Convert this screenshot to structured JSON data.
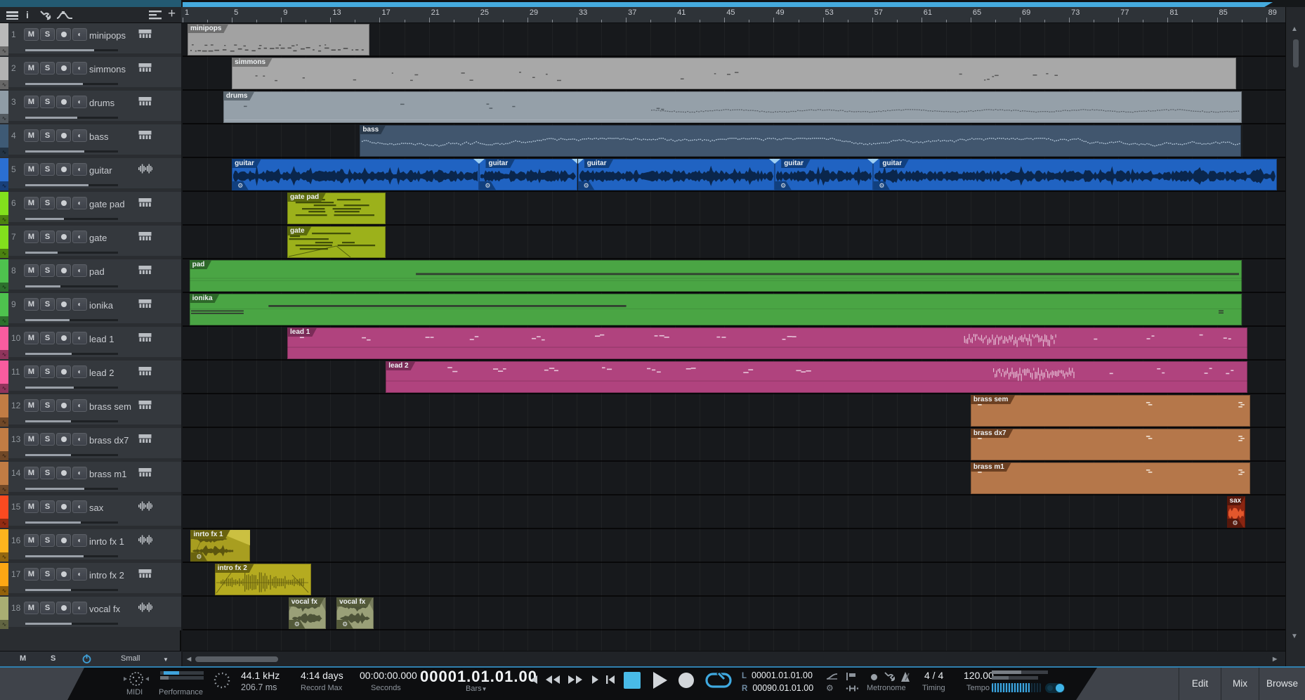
{
  "ruler": {
    "bar_label_start": 1,
    "bar_label_step": 4,
    "bar_label_end": 89,
    "loop_start_bar": 1,
    "loop_end_bar": 90
  },
  "toolbar": {
    "plus": "+",
    "info": "i"
  },
  "tracks": [
    {
      "num": "1",
      "name": "minipops",
      "type": "midi",
      "color": "#b9b9b9",
      "clipBody": "#a2a2a2",
      "clipTab": "#6f6f6f",
      "ink": "#3f3f3f",
      "vol": 0.74
    },
    {
      "num": "2",
      "name": "simmons",
      "type": "midi",
      "color": "#b2b2b2",
      "clipBody": "#a8a8a8",
      "clipTab": "#757575",
      "ink": "#4a4a4a",
      "vol": 0.62
    },
    {
      "num": "3",
      "name": "drums",
      "type": "midi",
      "color": "#8f9ca6",
      "clipBody": "#95a0a9",
      "clipTab": "#5f6a73",
      "ink": "#4b535a",
      "vol": 0.56
    },
    {
      "num": "4",
      "name": "bass",
      "type": "midi",
      "color": "#3e5a75",
      "clipBody": "#41566e",
      "clipTab": "#2a3a4c",
      "ink": "#bdd0e2",
      "vol": 0.64
    },
    {
      "num": "5",
      "name": "guitar",
      "type": "audio",
      "color": "#2b6fd2",
      "clipBody": "#2063c2",
      "clipTab": "#11407f",
      "ink": "#0a2346",
      "vol": 0.68
    },
    {
      "num": "6",
      "name": "gate pad",
      "type": "midi",
      "color": "#82e01d",
      "clipBody": "#9cb11b",
      "clipTab": "#5c6b0d",
      "ink": "#333f05",
      "vol": 0.42
    },
    {
      "num": "7",
      "name": "gate",
      "type": "midi",
      "color": "#82e01d",
      "clipBody": "#9cb11b",
      "clipTab": "#5c6b0d",
      "ink": "#333f05",
      "vol": 0.35
    },
    {
      "num": "8",
      "name": "pad",
      "type": "midi",
      "color": "#4ec24e",
      "clipBody": "#4aa544",
      "clipTab": "#2d6829",
      "ink": "#2e2e2e",
      "vol": 0.38
    },
    {
      "num": "9",
      "name": "ionika",
      "type": "midi",
      "color": "#4ec24e",
      "clipBody": "#4aa544",
      "clipTab": "#2d6829",
      "ink": "#2e2e2e",
      "vol": 0.48
    },
    {
      "num": "10",
      "name": "lead 1",
      "type": "midi",
      "color": "#f95c9f",
      "clipBody": "#b0437e",
      "clipTab": "#7b2c58",
      "ink": "#f2dcea",
      "vol": 0.5
    },
    {
      "num": "11",
      "name": "lead 2",
      "type": "midi",
      "color": "#f95c9f",
      "clipBody": "#b0437e",
      "clipTab": "#7b2c58",
      "ink": "#f2dcea",
      "vol": 0.52
    },
    {
      "num": "12",
      "name": "brass sem",
      "type": "midi",
      "color": "#c17c44",
      "clipBody": "#b5774a",
      "clipTab": "#6c4022",
      "ink": "#f4e8dc",
      "vol": 0.49
    },
    {
      "num": "13",
      "name": "brass dx7",
      "type": "midi",
      "color": "#c17c44",
      "clipBody": "#b5774a",
      "clipTab": "#6c4022",
      "ink": "#f4e8dc",
      "vol": 0.49
    },
    {
      "num": "14",
      "name": "brass m1",
      "type": "midi",
      "color": "#c17c44",
      "clipBody": "#b5774a",
      "clipTab": "#6c4022",
      "ink": "#f4e8dc",
      "vol": 0.64
    },
    {
      "num": "15",
      "name": "sax",
      "type": "audio",
      "color": "#fb4a20",
      "clipBody": "#8a2511",
      "clipTab": "#55170b",
      "ink": "#e85a2e",
      "vol": 0.6
    },
    {
      "num": "16",
      "name": "inrto fx 1",
      "type": "audio",
      "color": "#fdb41e",
      "clipBody": "#a89e20",
      "clipTab": "#6a630f",
      "ink": "#5c560e",
      "vol": 0.63
    },
    {
      "num": "17",
      "name": "intro fx 2",
      "type": "midi",
      "color": "#fca714",
      "clipBody": "#b5ab20",
      "clipTab": "#6a630f",
      "ink": "#5f590e",
      "vol": 0.49
    },
    {
      "num": "18",
      "name": "vocal fx",
      "type": "audio",
      "color": "#a9ae73",
      "clipBody": "#9aa078",
      "clipTab": "#545a3a",
      "ink": "#4d5338",
      "vol": 0.5
    }
  ],
  "clips": [
    {
      "track": 0,
      "label": "minipops",
      "start": 1.4,
      "end": 16.2,
      "kind": "dots-dense"
    },
    {
      "track": 1,
      "label": "simmons",
      "start": 5,
      "end": 86.6,
      "kind": "dots-sparse"
    },
    {
      "track": 2,
      "label": "drums",
      "start": 4.3,
      "end": 87,
      "kind": "drums"
    },
    {
      "track": 3,
      "label": "bass",
      "start": 15.4,
      "end": 87,
      "kind": "wave-dotted"
    },
    {
      "track": 4,
      "label": "guitar",
      "start": 5,
      "end": 25.1,
      "kind": "wave",
      "gear": true,
      "fadeTR": true
    },
    {
      "track": 4,
      "label": "guitar",
      "start": 25.1,
      "end": 33.1,
      "kind": "wave",
      "gear": true,
      "fadeTL": true,
      "fadeTR": true
    },
    {
      "track": 4,
      "label": "guitar",
      "start": 33.1,
      "end": 49.1,
      "kind": "wave",
      "gear": true,
      "fadeTL": true,
      "fadeTR": true
    },
    {
      "track": 4,
      "label": "guitar",
      "start": 49.1,
      "end": 57.1,
      "kind": "wave",
      "gear": true,
      "fadeTL": true,
      "fadeTR": true
    },
    {
      "track": 4,
      "label": "guitar",
      "start": 57.1,
      "end": 89.9,
      "kind": "wave",
      "gear": true,
      "fadeTL": true
    },
    {
      "track": 5,
      "label": "gate pad",
      "start": 9.5,
      "end": 17.5,
      "kind": "midi-bars"
    },
    {
      "track": 6,
      "label": "gate",
      "start": 9.5,
      "end": 17.5,
      "kind": "midi-bars-diag"
    },
    {
      "track": 7,
      "label": "pad",
      "start": 1.55,
      "end": 87,
      "kind": "pad-lines"
    },
    {
      "track": 8,
      "label": "ionika",
      "start": 1.55,
      "end": 87,
      "kind": "ionika-lines"
    },
    {
      "track": 9,
      "label": "lead 1",
      "start": 9.5,
      "end": 87.5,
      "kind": "dash-notes"
    },
    {
      "track": 10,
      "label": "lead 2",
      "start": 17.5,
      "end": 87.5,
      "kind": "dash-notes"
    },
    {
      "track": 11,
      "label": "brass sem",
      "start": 65,
      "end": 87.7,
      "kind": "brass-marks"
    },
    {
      "track": 12,
      "label": "brass dx7",
      "start": 65,
      "end": 87.7,
      "kind": "brass-marks"
    },
    {
      "track": 13,
      "label": "brass m1",
      "start": 65,
      "end": 87.7,
      "kind": "brass-marks"
    },
    {
      "track": 14,
      "label": "sax",
      "start": 85.8,
      "end": 87.3,
      "kind": "wave",
      "gear": true
    },
    {
      "track": 15,
      "label": "inrto fx 1",
      "start": 1.65,
      "end": 6.5,
      "kind": "fx1",
      "gear": true
    },
    {
      "track": 16,
      "label": "intro fx 2",
      "start": 3.6,
      "end": 11.4,
      "kind": "fx2"
    },
    {
      "track": 17,
      "label": "vocal fx",
      "start": 9.6,
      "end": 12.6,
      "kind": "vocal",
      "gear": true
    },
    {
      "track": 17,
      "label": "vocal fx",
      "start": 13.5,
      "end": 16.5,
      "kind": "vocal",
      "gear": true
    }
  ],
  "track_buttons": {
    "mute": "M",
    "solo": "S"
  },
  "footer": {
    "mute": "M",
    "solo": "S",
    "size": "Small"
  },
  "transport": {
    "midi_label": "MIDI",
    "performance_label": "Performance",
    "sample_rate": "44.1 kHz",
    "latency": "206.7 ms",
    "record_max_value": "4:14 days",
    "record_max_label": "Record Max",
    "seconds_value": "00:00:00.000",
    "seconds_label": "Seconds",
    "time_display": "00001.01.01.00",
    "time_format_label": "Bars",
    "loop_left_prefix": "L",
    "loop_left": "00001.01.01.00",
    "loop_right_prefix": "R",
    "loop_right": "00090.01.01.00",
    "metronome_label": "Metronome",
    "timing_value": "4 / 4",
    "timing_label": "Timing",
    "tempo_value": "120.00",
    "tempo_label": "Tempo",
    "buttons": [
      {
        "label": "Edit"
      },
      {
        "label": "Mix"
      },
      {
        "label": "Browse"
      }
    ]
  },
  "colors": {
    "accent": "#45b8e8",
    "loopbar": "#45aadd"
  }
}
